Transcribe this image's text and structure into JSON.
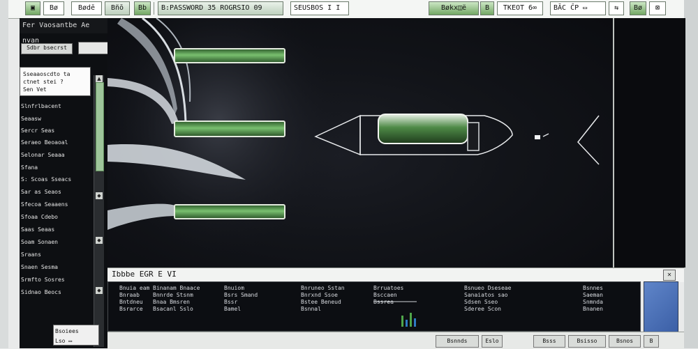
{
  "toolbar": {
    "buttons": [
      {
        "label": "▣",
        "style": "green"
      },
      {
        "label": "Bø"
      },
      {
        "label": "Bødē"
      },
      {
        "label": "Bñō"
      },
      {
        "label": "Bb"
      }
    ],
    "project_label": "B:PASSWORD 35 ROGRSIO 09",
    "search_value": "SEUSBOS I  I",
    "right_buttons": [
      {
        "label": "Bøkx◫ë",
        "style": "green"
      },
      {
        "label": "B"
      },
      {
        "label": "TKEOT 6∞"
      },
      {
        "label": "BĀC ĈP ▭"
      },
      {
        "label": "⇆"
      },
      {
        "label": "Bø"
      },
      {
        "label": "⊠"
      }
    ]
  },
  "sidebar": {
    "header": "Fer Vaosantbe    Ae nvan",
    "sub_label": "Sdbr bsecrst",
    "card_lines": [
      "Sseaaoscdto ta",
      "ctnet stei  ?",
      "Sen Vet"
    ],
    "items": [
      "Slnfrlbacent",
      "Seaasw",
      "Sercr Seas",
      "Seraeo Beoaoal",
      "Selonar Seaaa",
      "Sfana",
      "S: Scoas Sseacs",
      "Sar as Seaos",
      "Sfecoa Seaaens",
      "Sfoaa Cdebo",
      "Saas Seaas",
      "Soam Sonaen",
      "Sraans",
      "Snaen Sesma",
      "Srmfto Sosres",
      "Sidnao Beocs"
    ],
    "bottom_button": [
      "Bsoiees",
      "Lso  ▭"
    ]
  },
  "viewport": {
    "accent": "#4fa64a"
  },
  "bottom": {
    "title": "Ibbbe  EGR  E  VI",
    "columns": [
      [
        "Bnuia eam",
        "Bnraab",
        "Bntdneu",
        "Bsrarce"
      ],
      [
        "Binanam Bnaace",
        "Bnnrde Stsnm",
        "Bnaa Bmsren",
        "Bsacanl Sslo"
      ],
      [
        "Bnuiom",
        "Bsrs Smand",
        "Bssr",
        "Bamel"
      ],
      [
        "Bnruneo Sstan",
        "Bnrxnd Ssoe",
        "Bstee Beneud",
        "Bsnnal"
      ],
      [
        "Brruatoes",
        "Bsccaen",
        "Bssrea",
        ""
      ],
      [
        "Bsnueo Dseseae",
        "Sanaiatos sao",
        "Sdsen Sseo",
        "Sderee Scon"
      ],
      [
        "Bsnnes",
        "Saeman",
        "Snmnda",
        "Bnanen"
      ]
    ],
    "status_buttons": [
      "Bsnnds",
      "Eslo",
      "Bsss",
      "Bsisso",
      "Bsnos",
      "B"
    ]
  }
}
